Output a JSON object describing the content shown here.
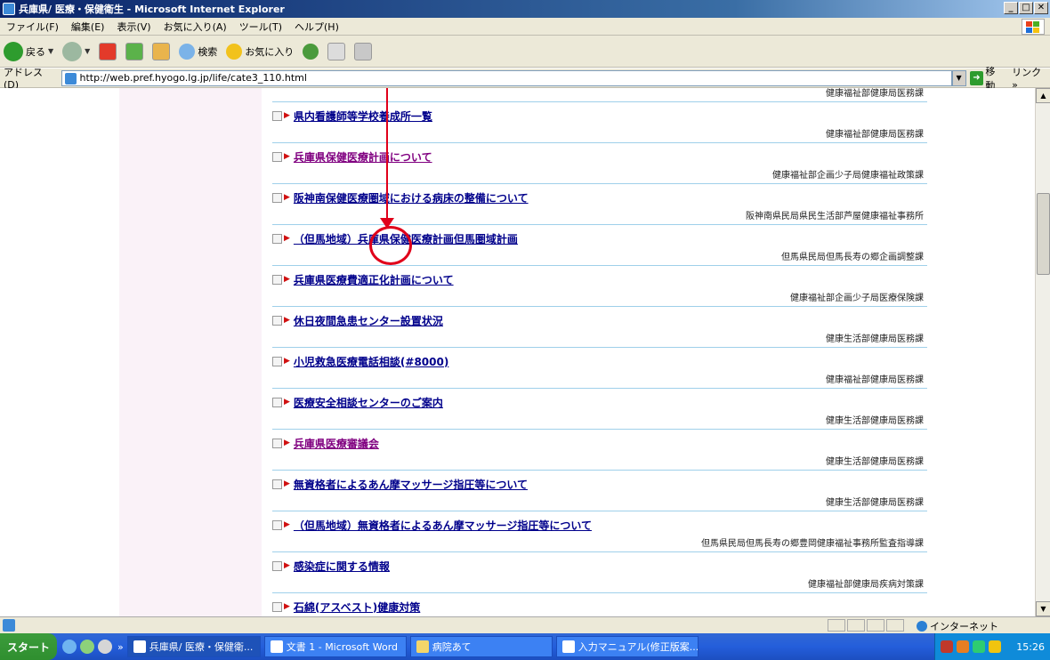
{
  "window": {
    "title": "兵庫県/ 医療・保健衛生 - Microsoft Internet Explorer",
    "controls": [
      "_",
      "□",
      "✕"
    ]
  },
  "menubar": {
    "items": [
      "ファイル(F)",
      "編集(E)",
      "表示(V)",
      "お気に入り(A)",
      "ツール(T)",
      "ヘルプ(H)"
    ]
  },
  "toolbar": {
    "back_label": "戻る",
    "search_label": "検索",
    "favorites_label": "お気に入り"
  },
  "address": {
    "label": "アドレス(D)",
    "url": "http://web.pref.hyogo.lg.jp/life/cate3_110.html",
    "go_label": "移動",
    "links_label": "リンク »"
  },
  "content": {
    "top_dept": "健康福祉部健康局医務課",
    "items": [
      {
        "title": "県内看護師等学校養成所一覧",
        "dept": "健康福祉部健康局医務課",
        "visited": false
      },
      {
        "title": "兵庫県保健医療計画について",
        "dept": "健康福祉部企画少子局健康福祉政策課",
        "visited": true
      },
      {
        "title": "阪神南保健医療圏域における病床の整備について",
        "dept": "阪神南県民局県民生活部芦屋健康福祉事務所",
        "visited": false
      },
      {
        "title": "（但馬地域）兵庫県保健医療計画但馬圏域計画",
        "dept": "但馬県民局但馬長寿の郷企画調整課",
        "visited": false
      },
      {
        "title": "兵庫県医療費適正化計画について",
        "dept": "健康福祉部企画少子局医療保険課",
        "visited": false
      },
      {
        "title": "休日夜間急患センター設置状況",
        "dept": "健康生活部健康局医務課",
        "visited": false
      },
      {
        "title": "小児救急医療電話相談(#8000)",
        "dept": "健康福祉部健康局医務課",
        "visited": false
      },
      {
        "title": "医療安全相談センターのご案内",
        "dept": "健康生活部健康局医務課",
        "visited": false
      },
      {
        "title": "兵庫県医療審議会",
        "dept": "健康生活部健康局医務課",
        "visited": true
      },
      {
        "title": "無資格者によるあん摩マッサージ指圧等について",
        "dept": "健康生活部健康局医務課",
        "visited": false
      },
      {
        "title": "（但馬地域）無資格者によるあん摩マッサージ指圧等について",
        "dept": "但馬県民局但馬長寿の郷豊岡健康福祉事務所監査指導課",
        "visited": false
      },
      {
        "title": "感染症に関する情報",
        "dept": "健康福祉部健康局疾病対策課",
        "visited": false
      },
      {
        "title": "石綿(アスベスト)健康対策",
        "dept": "",
        "visited": false
      }
    ]
  },
  "statusbar": {
    "zone": "インターネット"
  },
  "taskbar": {
    "start_label": "スタート",
    "tasks": [
      "兵庫県/ 医療・保健衛...",
      "文書 1 - Microsoft Word",
      "病院あて",
      "入力マニュアル(修正版案..."
    ],
    "clock": "15:26"
  }
}
